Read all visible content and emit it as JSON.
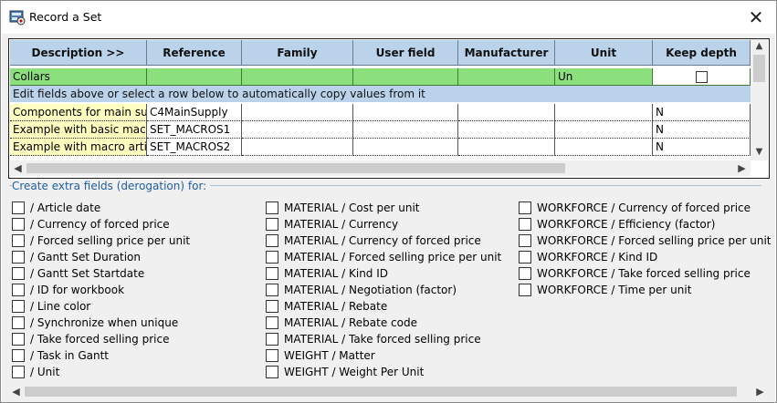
{
  "window": {
    "title": "Record a Set",
    "close_glyph": "✕"
  },
  "grid": {
    "columns": [
      "Description >>",
      "Reference",
      "Family",
      "User field",
      "Manufacturer",
      "Unit",
      "Keep depth"
    ],
    "edit_row": {
      "description": "Collars",
      "reference": "",
      "family": "",
      "user_field": "",
      "manufacturer": "",
      "unit": "Un",
      "keep_depth": false
    },
    "info_text": "Edit fields above or select a row below to automatically copy values from it",
    "rows": [
      {
        "description": "Components for main supply",
        "reference": "C4MainSupply",
        "family": "",
        "user_field": "",
        "manufacturer": "",
        "unit": "",
        "keep_depth": "N"
      },
      {
        "description": "Example with basic macros",
        "reference": "SET_MACROS1",
        "family": "",
        "user_field": "",
        "manufacturer": "",
        "unit": "",
        "keep_depth": "N"
      },
      {
        "description": "Example with macro articles",
        "reference": "SET_MACROS2",
        "family": "",
        "user_field": "",
        "manufacturer": "",
        "unit": "",
        "keep_depth": "N"
      }
    ]
  },
  "extra_fields": {
    "group_label": "Create extra fields (derogation) for:",
    "column1": [
      {
        "label": "/ Article date",
        "checked": false
      },
      {
        "label": "/ Currency of forced price",
        "checked": false
      },
      {
        "label": "/ Forced selling price per unit",
        "checked": false
      },
      {
        "label": "/ Gantt Set Duration",
        "checked": false
      },
      {
        "label": "/ Gantt Set Startdate",
        "checked": false
      },
      {
        "label": "/ ID for workbook",
        "checked": false
      },
      {
        "label": "/ Line color",
        "checked": false
      },
      {
        "label": "/ Synchronize when unique",
        "checked": false
      },
      {
        "label": "/ Take forced selling price",
        "checked": false
      },
      {
        "label": "/ Task in Gantt",
        "checked": false
      },
      {
        "label": "/ Unit",
        "checked": false
      }
    ],
    "column2": [
      {
        "label": "MATERIAL / Cost per unit",
        "checked": false
      },
      {
        "label": "MATERIAL / Currency",
        "checked": false
      },
      {
        "label": "MATERIAL / Currency of forced price",
        "checked": false
      },
      {
        "label": "MATERIAL / Forced selling price per unit",
        "checked": false
      },
      {
        "label": "MATERIAL / Kind ID",
        "checked": false
      },
      {
        "label": "MATERIAL / Negotiation (factor)",
        "checked": false
      },
      {
        "label": "MATERIAL / Rebate",
        "checked": false
      },
      {
        "label": "MATERIAL / Rebate code",
        "checked": false
      },
      {
        "label": "MATERIAL / Take forced selling price",
        "checked": false
      },
      {
        "label": "WEIGHT / Matter",
        "checked": false
      },
      {
        "label": "WEIGHT / Weight Per Unit",
        "checked": false
      }
    ],
    "column3": [
      {
        "label": "WORKFORCE / Currency of forced price",
        "checked": false
      },
      {
        "label": "WORKFORCE / Efficiency (factor)",
        "checked": false
      },
      {
        "label": "WORKFORCE / Forced selling price per unit",
        "checked": false
      },
      {
        "label": "WORKFORCE / Kind ID",
        "checked": false
      },
      {
        "label": "WORKFORCE / Take forced selling price",
        "checked": false
      },
      {
        "label": "WORKFORCE / Time per unit",
        "checked": false
      }
    ]
  },
  "scroll_glyphs": {
    "up": "▲",
    "down": "▼",
    "left": "◀",
    "right": "▶"
  }
}
